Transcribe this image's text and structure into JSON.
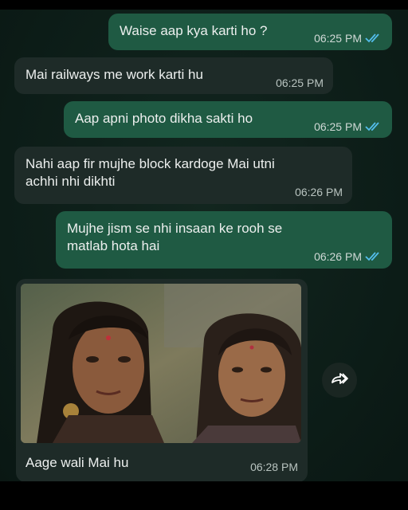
{
  "messages": [
    {
      "text": "Waise aap kya karti ho ?",
      "time": "06:25 PM"
    },
    {
      "text": "Mai railways me work karti hu",
      "time": "06:25 PM"
    },
    {
      "text": "Aap apni photo dikha sakti ho",
      "time": "06:25 PM"
    },
    {
      "line1": "Nahi aap fir mujhe block kardoge Mai utni",
      "line2": "achhi nhi dikhti",
      "time": "06:26 PM"
    },
    {
      "line1": "Mujhe jism se nhi insaan ke rooh se",
      "line2": "matlab hota hai",
      "time": "06:26 PM"
    }
  ],
  "photo_message": {
    "caption": "Aage wali Mai hu",
    "time": "06:28 PM"
  },
  "icons": {
    "read_receipt": "double-check-icon",
    "forward": "forward-icon"
  },
  "colors": {
    "outgoing": "#1f5a43",
    "incoming": "#1e2b28",
    "ticks": "#53bdeb"
  }
}
